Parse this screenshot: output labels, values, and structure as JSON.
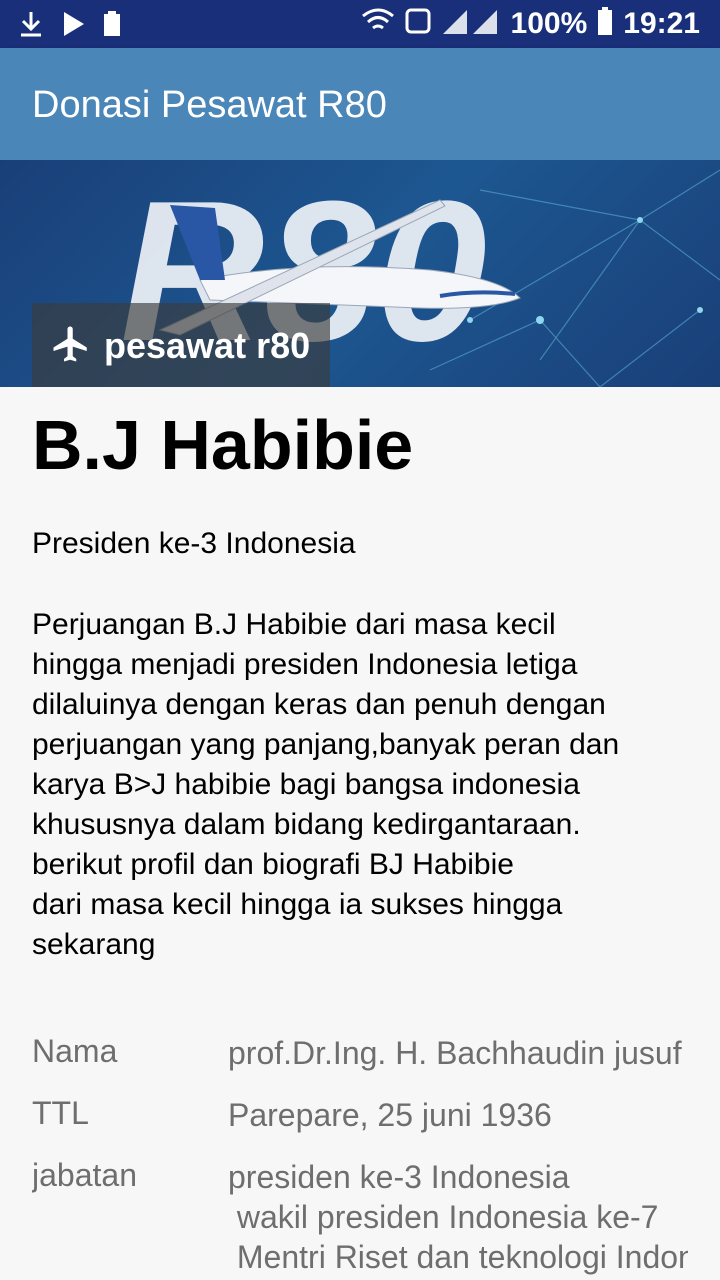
{
  "status_bar": {
    "battery_percent": "100%",
    "time": "19:21",
    "icons": [
      "download-icon",
      "play-store-icon",
      "battery-saver-icon",
      "wifi-icon",
      "hd-icon",
      "signal-icon",
      "battery-icon"
    ]
  },
  "app_bar": {
    "title": "Donasi Pesawat R80",
    "background": "#4a86b8"
  },
  "banner": {
    "chip_label": "pesawat r80",
    "chip_icon": "airplane-icon"
  },
  "profile": {
    "name": "B.J Habibie",
    "subtitle": "Presiden ke-3 Indonesia",
    "description_lines": [
      "Perjuangan B.J Habibie dari masa kecil",
      "hingga menjadi presiden Indonesia letiga",
      "dilaluinya dengan keras dan penuh dengan",
      "perjuangan yang panjang,banyak peran dan",
      "karya B>J habibie bagi bangsa indonesia",
      "khususnya dalam bidang kedirgantaraan.",
      "berikut profil dan biografi BJ Habibie",
      "dari masa kecil hingga ia sukses hingga",
      "sekarang"
    ]
  },
  "info": [
    {
      "label": "Nama",
      "value_lines": [
        "prof.Dr.Ing. H. Bachhaudin jusuf Habibie"
      ]
    },
    {
      "label": "TTL",
      "value_lines": [
        "Parepare, 25 juni 1936"
      ]
    },
    {
      "label": "jabatan",
      "value_lines": [
        "presiden ke-3 Indonesia",
        " wakil presiden Indonesia ke-7",
        " Mentri Riset dan teknologi Indonesia"
      ]
    }
  ]
}
